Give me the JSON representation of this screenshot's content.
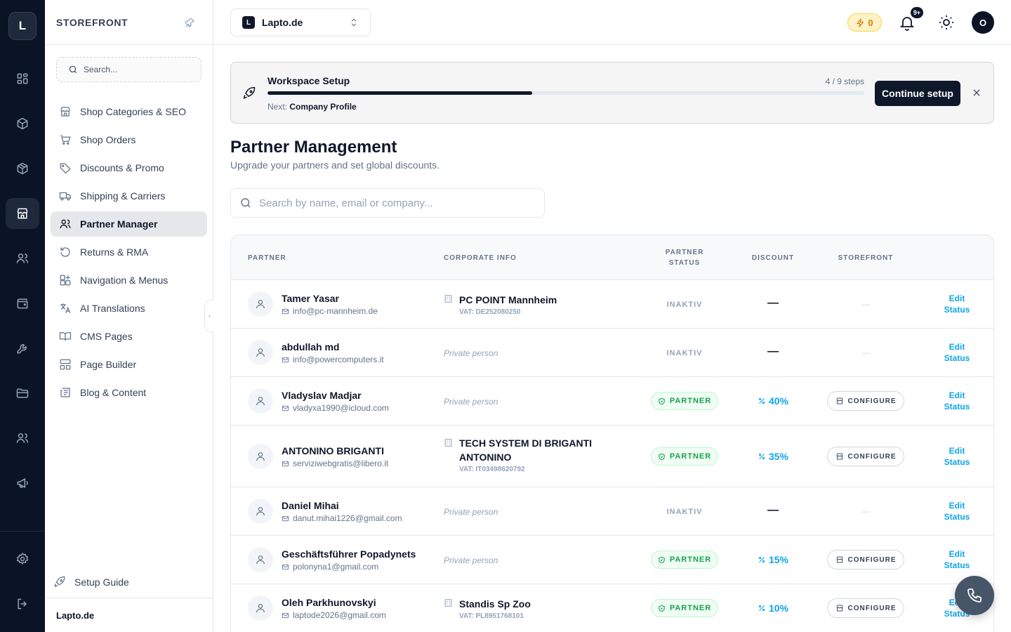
{
  "rail": {
    "logo": "L",
    "icons": [
      "dashboard-icon",
      "box-icon",
      "package-icon",
      "store-icon",
      "users-icon",
      "wallet-icon",
      "wrench-icon",
      "folder-icon",
      "team-icon",
      "megaphone-icon",
      "settings-icon",
      "logout-icon"
    ],
    "active": "store-icon"
  },
  "sidebar": {
    "title": "STOREFRONT",
    "search_placeholder": "Search...",
    "items": [
      {
        "label": "Shop Categories & SEO",
        "icon": "store-icon"
      },
      {
        "label": "Shop Orders",
        "icon": "cart-icon"
      },
      {
        "label": "Discounts & Promo",
        "icon": "tag-icon"
      },
      {
        "label": "Shipping & Carriers",
        "icon": "truck-icon"
      },
      {
        "label": "Partner Manager",
        "icon": "users-icon",
        "active": true
      },
      {
        "label": "Returns & RMA",
        "icon": "return-icon"
      },
      {
        "label": "Navigation & Menus",
        "icon": "grid-plus-icon"
      },
      {
        "label": "AI Translations",
        "icon": "translate-icon"
      },
      {
        "label": "CMS Pages",
        "icon": "book-icon"
      },
      {
        "label": "Page Builder",
        "icon": "layout-icon"
      },
      {
        "label": "Blog & Content",
        "icon": "newspaper-icon"
      }
    ],
    "setup_guide": "Setup Guide",
    "footer": "Lapto.de"
  },
  "topbar": {
    "workspace_badge": "L",
    "workspace": "Lapto.de",
    "credits": "0",
    "notifications": "9+",
    "avatar": "O"
  },
  "banner": {
    "title": "Workspace Setup",
    "steps": "4 / 9 steps",
    "progress": 0.444,
    "next_label": "Next:",
    "next_value": "Company Profile",
    "button": "Continue setup"
  },
  "page": {
    "title": "Partner Management",
    "subtitle": "Upgrade your partners and set global discounts.",
    "search_placeholder": "Search by name, email or company..."
  },
  "table": {
    "headers": {
      "partner": "PARTNER",
      "corporate": "CORPORATE INFO",
      "status_line1": "PARTNER",
      "status_line2": "STATUS",
      "discount": "DISCOUNT",
      "storefront": "STOREFRONT"
    },
    "rows": [
      {
        "name": "Tamer Yasar",
        "email": "info@pc-mannheim.de",
        "company": "PC POINT Mannheim",
        "vat": "VAT: DE252080250",
        "status": "INAKTIV",
        "discount": "—",
        "storefront": "—",
        "edit": "Edit",
        "edit2": "Status"
      },
      {
        "name": "abdullah md",
        "email": "info@powercomputers.it",
        "private": "Private person",
        "status": "INAKTIV",
        "discount": "—",
        "storefront": "—",
        "edit": "Edit",
        "edit2": "Status"
      },
      {
        "name": "Vladyslav Madjar",
        "email": "vladyxa1990@icloud.com",
        "private": "Private person",
        "status": "PARTNER",
        "discount": "40%",
        "storefront": "CONFIGURE",
        "edit": "Edit",
        "edit2": "Status"
      },
      {
        "name": "ANTONINO BRIGANTI",
        "email": "serviziwebgratis@libero.it",
        "company": "TECH SYSTEM DI BRIGANTI ANTONINO",
        "vat": "VAT: IT03498620792",
        "status": "PARTNER",
        "discount": "35%",
        "storefront": "CONFIGURE",
        "edit": "Edit",
        "edit2": "Status"
      },
      {
        "name": "Daniel Mihai",
        "email": "danut.mihai1226@gmail.com",
        "private": "Private person",
        "status": "INAKTIV",
        "discount": "—",
        "storefront": "—",
        "edit": "Edit",
        "edit2": "Status"
      },
      {
        "name": "Geschäftsführer Popadynets",
        "email": "polonyna1@gmail.com",
        "private": "Private person",
        "status": "PARTNER",
        "discount": "15%",
        "storefront": "CONFIGURE",
        "edit": "Edit",
        "edit2": "Status"
      },
      {
        "name": "Oleh Parkhunovskyi",
        "email": "laptode2026@gmail.com",
        "company": "Standis Sp Zoo",
        "vat": "VAT: PL8951768101",
        "status": "PARTNER",
        "discount": "10%",
        "storefront": "CONFIGURE",
        "edit": "Edit",
        "edit2": "Status"
      }
    ]
  },
  "fab": {
    "icon": "phone-icon"
  }
}
